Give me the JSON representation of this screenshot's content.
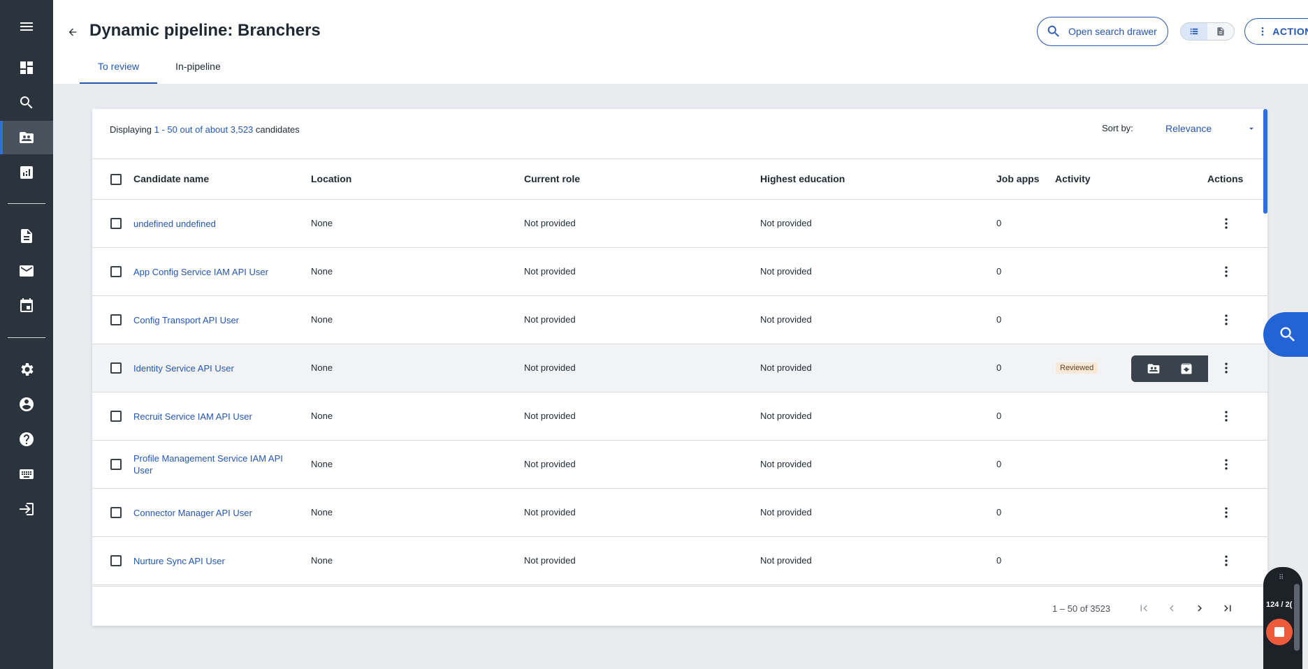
{
  "header": {
    "title": "Dynamic pipeline: Branchers",
    "tabs": [
      {
        "label": "To review",
        "active": true
      },
      {
        "label": "In-pipeline",
        "active": false
      }
    ],
    "search_drawer_label": "Open search drawer",
    "actions_label": "ACTIONS"
  },
  "summary": {
    "prefix": "Displaying",
    "range": "1 - 50 out of about 3,523",
    "suffix": "candidates",
    "sort_label": "Sort by:",
    "sort_value": "Relevance"
  },
  "table": {
    "columns": [
      "Candidate name",
      "Location",
      "Current role",
      "Highest education",
      "Job apps",
      "Activity",
      "Actions"
    ],
    "rows": [
      {
        "name": "undefined undefined",
        "location": "None",
        "role": "Not provided",
        "education": "Not provided",
        "apps": "0",
        "activity": ""
      },
      {
        "name": "App Config Service IAM API User",
        "location": "None",
        "role": "Not provided",
        "education": "Not provided",
        "apps": "0",
        "activity": ""
      },
      {
        "name": "Config Transport API User",
        "location": "None",
        "role": "Not provided",
        "education": "Not provided",
        "apps": "0",
        "activity": ""
      },
      {
        "name": "Identity Service API User",
        "location": "None",
        "role": "Not provided",
        "education": "Not provided",
        "apps": "0",
        "activity": "Reviewed"
      },
      {
        "name": "Recruit Service IAM API User",
        "location": "None",
        "role": "Not provided",
        "education": "Not provided",
        "apps": "0",
        "activity": ""
      },
      {
        "name": "Profile Management Service IAM API User",
        "location": "None",
        "role": "Not provided",
        "education": "Not provided",
        "apps": "0",
        "activity": ""
      },
      {
        "name": "Connector Manager API User",
        "location": "None",
        "role": "Not provided",
        "education": "Not provided",
        "apps": "0",
        "activity": ""
      },
      {
        "name": "Nurture Sync API User",
        "location": "None",
        "role": "Not provided",
        "education": "Not provided",
        "apps": "0",
        "activity": ""
      }
    ]
  },
  "pagination": {
    "info": "1 – 50 of 3523"
  },
  "recorder": {
    "count": "124 / 2("
  },
  "sidebar": {
    "icons": [
      "menu-icon",
      "dashboard-icon",
      "search-icon",
      "pipeline-icon",
      "reports-icon",
      "document-icon",
      "mail-icon",
      "calendar-icon",
      "settings-icon",
      "account-icon",
      "help-icon",
      "keyboard-icon",
      "logout-icon"
    ]
  },
  "colors": {
    "sidebar": "#2b333d",
    "accent": "#2456b4",
    "fab": "#2263d6",
    "reviewed_badge": "#fbe9d7",
    "record_stop": "#ef5a3c"
  }
}
